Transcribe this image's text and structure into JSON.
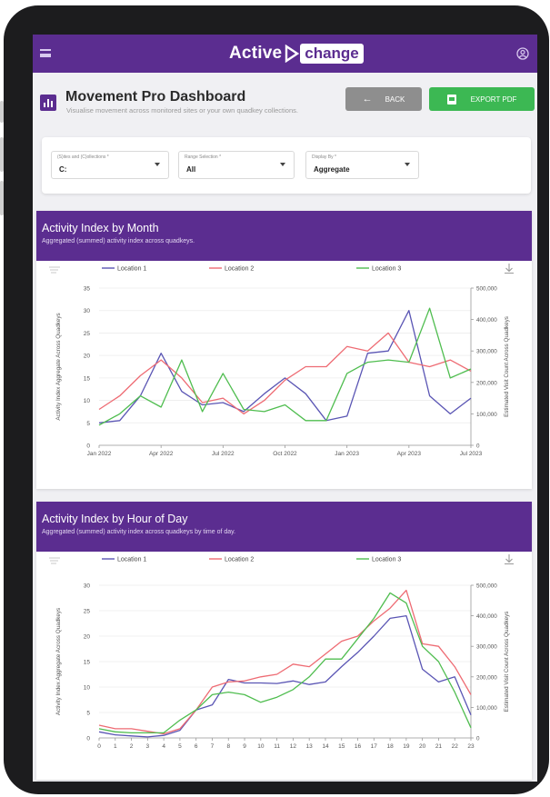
{
  "app": {
    "logo_left": "Active",
    "logo_right": "change"
  },
  "header": {
    "title": "Movement Pro Dashboard",
    "subtitle": "Visualise movement across monitored sites or your own quadkey collections.",
    "back_label": "BACK",
    "export_label": "EXPORT PDF"
  },
  "filters": [
    {
      "label": "(S)ites and (C)ollections *",
      "value": "C:"
    },
    {
      "label": "Range Selection *",
      "value": "All"
    },
    {
      "label": "Display By *",
      "value": "Aggregate"
    }
  ],
  "colors": {
    "brand": "#5b2d90",
    "export": "#3cb853",
    "back": "#8e8e8e",
    "location1": "#5a55b4",
    "location2": "#ee6b73",
    "location3": "#4fbd4f"
  },
  "icons": [
    "menu-icon",
    "user-icon",
    "bar-chart-icon",
    "arrow-left-icon",
    "pdf-icon",
    "filter-lines-icon",
    "download-icon",
    "chevron-down-icon"
  ],
  "chart_data": [
    {
      "type": "line",
      "title": "Activity Index by Month",
      "subtitle": "Aggregated (summed) activity index across quadkeys.",
      "ylabel": "Activity Index Aggregate Across Quadkeys",
      "y2label": "Estimated Visit Count Across Quadkeys",
      "ylim": [
        0,
        35
      ],
      "yticks": [
        0,
        5,
        10,
        15,
        20,
        25,
        30,
        35
      ],
      "y2ticks": [
        "0",
        "100,000",
        "200,000",
        "300,000",
        "400,000",
        "500,000"
      ],
      "xticks": [
        "Jan 2022",
        "Apr 2022",
        "Jul 2022",
        "Oct 2022",
        "Jan 2023",
        "Apr 2023",
        "Jul 2023"
      ],
      "x": [
        "Jan 2022",
        "Feb 2022",
        "Mar 2022",
        "Apr 2022",
        "May 2022",
        "Jun 2022",
        "Jul 2022",
        "Aug 2022",
        "Sep 2022",
        "Oct 2022",
        "Nov 2022",
        "Dec 2022",
        "Jan 2023",
        "Feb 2023",
        "Mar 2023",
        "Apr 2023",
        "May 2023",
        "Jun 2023",
        "Jul 2023"
      ],
      "legend_position": "top",
      "grid": true,
      "series": [
        {
          "name": "Location 1",
          "values": [
            5,
            5.5,
            11,
            20.5,
            12,
            9,
            9.5,
            7.5,
            11.5,
            15,
            11.5,
            5.5,
            6.5,
            20.5,
            21,
            30,
            11,
            7,
            10.5
          ]
        },
        {
          "name": "Location 2",
          "values": [
            8,
            11,
            15.5,
            19,
            15,
            9.5,
            10.5,
            7,
            10,
            14.5,
            17.5,
            17.5,
            22,
            21,
            25,
            18.5,
            17.5,
            19,
            16.5
          ]
        },
        {
          "name": "Location 3",
          "values": [
            4.5,
            7,
            11,
            8.5,
            19,
            7.5,
            16,
            8,
            7.5,
            9,
            5.5,
            5.5,
            16,
            18.5,
            19,
            18.5,
            30.5,
            15,
            17
          ]
        }
      ]
    },
    {
      "type": "line",
      "title": "Activity Index by Hour of Day",
      "subtitle": "Aggregated (summed) activity index across quadkeys by time of day.",
      "ylabel": "Activity Index Aggregate Across Quadkeys",
      "y2label": "Estimated Visit Count Across Quadkeys",
      "ylim": [
        0,
        30
      ],
      "yticks": [
        0,
        5,
        10,
        15,
        20,
        25,
        30
      ],
      "y2ticks": [
        "0",
        "100,000",
        "200,000",
        "300,000",
        "400,000",
        "500,000"
      ],
      "xticks": [
        "0",
        "1",
        "2",
        "3",
        "4",
        "5",
        "6",
        "7",
        "8",
        "9",
        "10",
        "11",
        "12",
        "13",
        "14",
        "15",
        "16",
        "17",
        "18",
        "19",
        "20",
        "21",
        "22",
        "23"
      ],
      "x": [
        0,
        1,
        2,
        3,
        4,
        5,
        6,
        7,
        8,
        9,
        10,
        11,
        12,
        13,
        14,
        15,
        16,
        17,
        18,
        19,
        20,
        21,
        22,
        23
      ],
      "legend_position": "top",
      "grid": true,
      "series": [
        {
          "name": "Location 1",
          "values": [
            1.2,
            0.6,
            0.4,
            0.2,
            0.5,
            1.5,
            5.5,
            6.5,
            11.5,
            10.8,
            10.8,
            10.7,
            11.2,
            10.5,
            11.0,
            14.0,
            16.8,
            20.0,
            23.5,
            24.0,
            13.5,
            11.0,
            12.0,
            4.5
          ]
        },
        {
          "name": "Location 2",
          "values": [
            2.5,
            1.8,
            1.8,
            1.3,
            0.8,
            1.8,
            5.5,
            10.0,
            11.0,
            11.2,
            12.0,
            12.5,
            14.5,
            14.0,
            16.5,
            19.0,
            20.0,
            23.0,
            25.5,
            29.0,
            18.5,
            18.0,
            14.0,
            8.5
          ]
        },
        {
          "name": "Location 3",
          "values": [
            1.8,
            1.2,
            1.0,
            1.0,
            1.0,
            3.5,
            5.5,
            8.5,
            9.0,
            8.5,
            7.0,
            8.0,
            9.5,
            12.0,
            15.5,
            15.5,
            19.5,
            23.5,
            28.5,
            26.5,
            18.0,
            15.0,
            9.0,
            2.0
          ]
        }
      ]
    }
  ]
}
